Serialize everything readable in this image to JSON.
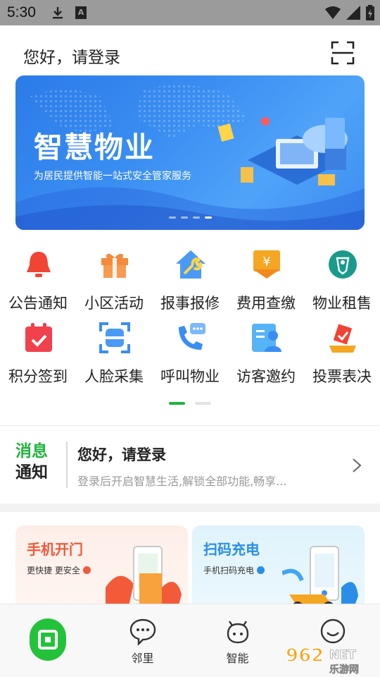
{
  "status_bar": {
    "time": "5:30",
    "a_badge": "A",
    "icons": [
      "download-icon",
      "a-notification-icon",
      "wifi-icon",
      "cell-signal-icon",
      "battery-icon"
    ]
  },
  "header": {
    "greeting": "您好，请登录",
    "scan_icon": "scan-icon"
  },
  "banner": {
    "title": "智慧物业",
    "subtitle": "为居民提供智能一站式安全管家服务",
    "dots": 4,
    "active_dot": 3
  },
  "grid": {
    "items": [
      {
        "label": "公告通知",
        "icon": "bell-icon",
        "color": "#f04434"
      },
      {
        "label": "小区活动",
        "icon": "gift-icon",
        "color": "#f58a3c"
      },
      {
        "label": "报事报修",
        "icon": "wrench-house-icon",
        "color": "#3a8df3"
      },
      {
        "label": "费用查缴",
        "icon": "yuan-icon",
        "color": "#f5a623"
      },
      {
        "label": "物业租售",
        "icon": "tag-icon",
        "color": "#1a9a8a"
      },
      {
        "label": "积分签到",
        "icon": "calendar-check-icon",
        "color": "#f0414d"
      },
      {
        "label": "人脸采集",
        "icon": "face-scan-icon",
        "color": "#3a8df3"
      },
      {
        "label": "呼叫物业",
        "icon": "phone-chat-icon",
        "color": "#3a8df3"
      },
      {
        "label": "访客邀约",
        "icon": "visitor-icon",
        "color": "#3fa6f3"
      },
      {
        "label": "投票表决",
        "icon": "vote-icon",
        "color": "#f04434"
      }
    ],
    "pages": 2,
    "active_page": 1
  },
  "message": {
    "logo_line1": "消息",
    "logo_line2": "通知",
    "title": "您好，请登录",
    "text": "登录后开启智慧生活,解锁全部功能,畅享..."
  },
  "cards": [
    {
      "title": "手机开门",
      "subtitle": "更快捷 更安全",
      "accent": "#ee5a3c"
    },
    {
      "title": "扫码充电",
      "subtitle": "手机扫码充电",
      "accent": "#2a8ee8"
    }
  ],
  "bottom_nav": {
    "items": [
      {
        "label": "",
        "icon": "home-icon"
      },
      {
        "label": "邻里",
        "icon": "chat-bubble-icon"
      },
      {
        "label": "智能",
        "icon": "robot-icon"
      },
      {
        "label": "",
        "icon": "smile-icon"
      }
    ]
  },
  "watermark": {
    "text1": "962",
    "text2": "NET",
    "text3": "乐游网"
  },
  "colors": {
    "brand_green": "#22b33a",
    "banner_blue": "#3a8ef2"
  }
}
